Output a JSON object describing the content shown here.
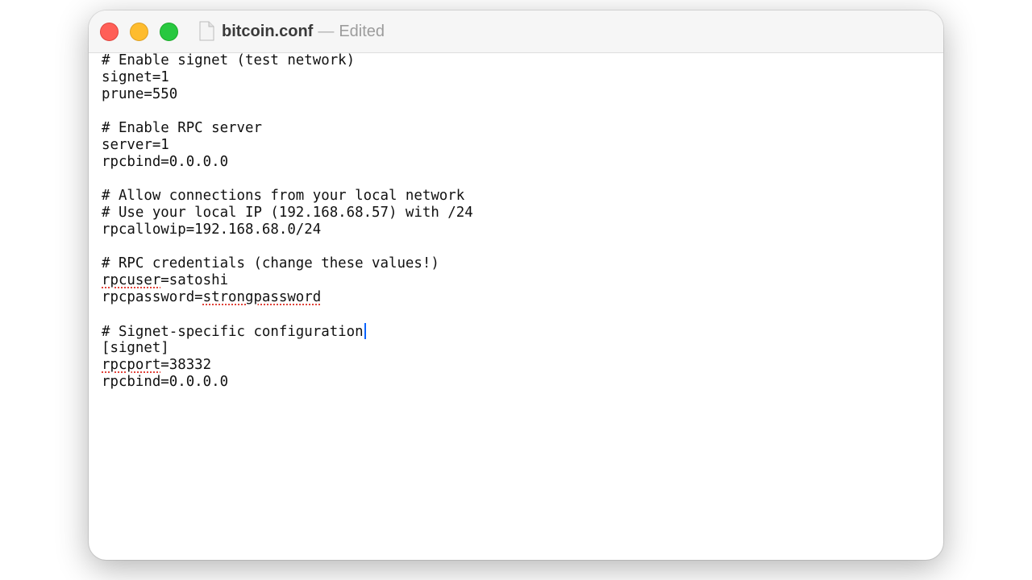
{
  "window": {
    "file_name": "bitcoin.conf",
    "separator": "—",
    "status": "Edited"
  },
  "editor": {
    "line1": "# Enable signet (test network)",
    "line2": "signet=1",
    "line3": "prune=550",
    "line5": "# Enable RPC server",
    "line6": "server=1",
    "line7": "rpcbind=0.0.0.0",
    "line9": "# Allow connections from your local network",
    "line10": "# Use your local IP (192.168.68.57) with /24",
    "line11": "rpcallowip=192.168.68.0/24",
    "line13": "# RPC credentials (change these values!)",
    "line14_key": "rpcuser",
    "line14_rest": "=satoshi",
    "line15_key": "rpcpassword=",
    "line15_val": "strongpassword",
    "line17": "# Signet-specific configuration",
    "line18": "[signet]",
    "line19_key": "rpcport",
    "line19_rest": "=38332",
    "line20": "rpcbind=0.0.0.0"
  },
  "colors": {
    "close": "#ff5f57",
    "minimize": "#febc2e",
    "zoom": "#28c840",
    "caret": "#0a64ff",
    "spellcheck": "#e0433a"
  },
  "icons": {
    "close": "close-icon",
    "minimize": "minimize-icon",
    "zoom": "zoom-icon",
    "document": "document-icon"
  }
}
